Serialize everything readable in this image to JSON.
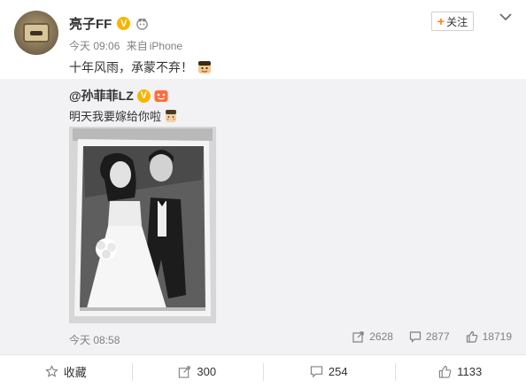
{
  "post": {
    "username": "亮子FF",
    "time": "今天 09:06",
    "source_prefix": "来自",
    "source": "iPhone",
    "text": "十年风雨，承蒙不弃！",
    "follow_label": "关注"
  },
  "repost": {
    "username": "@孙菲菲LZ",
    "text": "明天我要嫁给你啦",
    "time": "今天 08:58",
    "stats": {
      "reposts": "2628",
      "comments": "2877",
      "likes": "18719"
    }
  },
  "actions": {
    "favorite_label": "收藏",
    "reposts": "300",
    "comments": "254",
    "likes": "1133"
  },
  "colors": {
    "accent": "#ff8200",
    "verified": "#f7b500",
    "repost_bg": "#f2f2f5"
  }
}
